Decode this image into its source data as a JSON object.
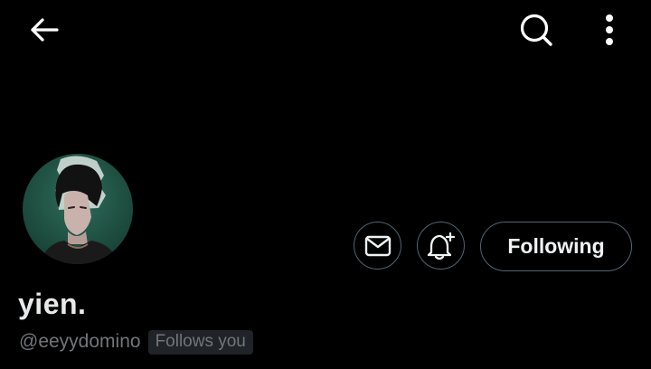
{
  "header": {
    "back_icon": "arrow-left-icon",
    "search_icon": "search-icon",
    "more_icon": "more-vertical-icon"
  },
  "profile": {
    "display_name": "yien.",
    "handle": "@eeyydomino",
    "follows_you_label": "Follows you",
    "following_label": "Following",
    "message_icon": "envelope-icon",
    "notify_icon": "bell-plus-icon",
    "avatar": "profile-avatar"
  },
  "colors": {
    "background": "#000000",
    "text_primary": "#e7e9ea",
    "text_secondary": "#71767b",
    "button_border": "#536471",
    "badge_bg": "#202327",
    "avatar_bg": "#1f5446"
  }
}
